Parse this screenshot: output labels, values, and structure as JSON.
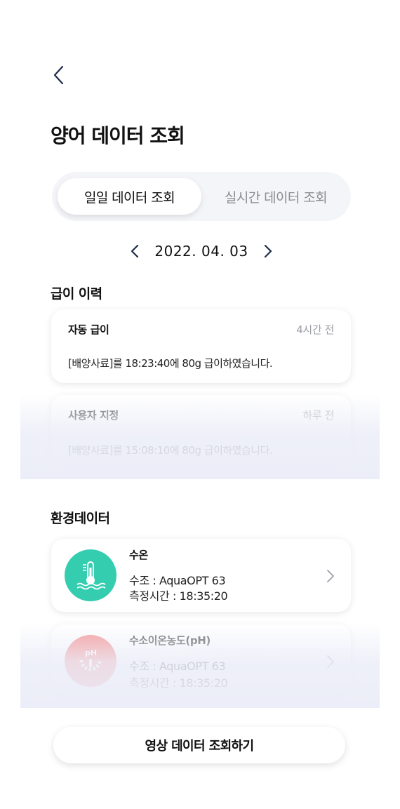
{
  "header": {
    "title": "양어 데이터 조회"
  },
  "tabs": [
    {
      "label": "일일 데이터 조회",
      "active": true
    },
    {
      "label": "실시간 데이터 조회",
      "active": false
    }
  ],
  "date_nav": {
    "date": "2022. 04. 03"
  },
  "feeding_history": {
    "title": "급이 이력",
    "items": [
      {
        "type": "자동 급이",
        "time_ago": "4시간 전",
        "message": "[배양사료]를 18:23:40에 80g 급이하였습니다."
      },
      {
        "type": "사용자 지정",
        "time_ago": "하루 전",
        "message": "[배양사료]를 15:08:10에 80g 급이하였습니다."
      }
    ]
  },
  "environment": {
    "title": "환경데이터",
    "items": [
      {
        "name": "수온",
        "tank": "수조 : AquaOPT 63",
        "measured": "측정시간 : 18:35:20",
        "icon": "thermometer-water-icon",
        "color": "#35cdb0"
      },
      {
        "name": "수소이온농도(pH)",
        "tank": "수조 : AquaOPT 63",
        "measured": "측정시간 : 18:35:20",
        "icon": "ph-gauge-icon",
        "color": "#f26b6b"
      }
    ]
  },
  "bottom_button": {
    "label": "영상 데이터 조회하기"
  },
  "colors": {
    "accent_teal": "#35cdb0",
    "accent_red": "#f26b6b",
    "muted_text": "#9b9ea5"
  }
}
